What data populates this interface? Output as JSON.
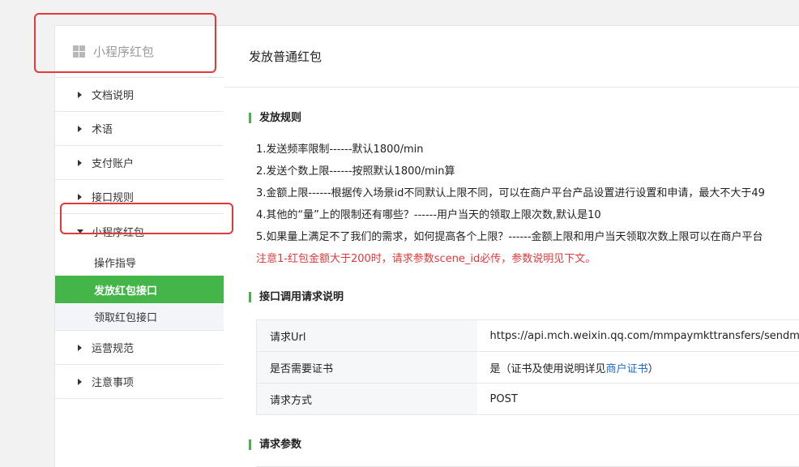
{
  "sidebar": {
    "title": "小程序红包",
    "items": [
      {
        "label": "文档说明"
      },
      {
        "label": "术语"
      },
      {
        "label": "支付账户"
      },
      {
        "label": "接口规则"
      }
    ],
    "open_item": {
      "label": "小程序红包",
      "children": [
        {
          "label": "操作指导"
        },
        {
          "label": "发放红包接口"
        },
        {
          "label": "领取红包接口"
        }
      ]
    },
    "items_after": [
      {
        "label": "运营规范"
      },
      {
        "label": "注意事项"
      }
    ]
  },
  "main": {
    "page_title": "发放普通红包",
    "rules_section": {
      "title": "发放规则",
      "lines": [
        "1.发送频率限制------默认1800/min",
        "2.发送个数上限------按照默认1800/min算",
        "3.金额上限------根据传入场景id不同默认上限不同，可以在商户平台产品设置进行设置和申请，最大不大于49",
        "4.其他的“量”上的限制还有哪些？------用户当天的领取上限次数,默认是10",
        "5.如果量上满足不了我们的需求，如何提高各个上限？------金额上限和用户当天领取次数上限可以在商户平台"
      ],
      "warning": "注意1-红包金额大于200时，请求参数scene_id必传，参数说明见下文。"
    },
    "request_section": {
      "title": "接口调用请求说明",
      "rows": [
        {
          "key": "请求Url",
          "value": "https://api.mch.weixin.qq.com/mmpaymkttransfers/sendminipr"
        },
        {
          "key": "是否需要证书",
          "value_prefix": "是（证书及使用说明详见",
          "value_link": "商户证书",
          "value_suffix": "）"
        },
        {
          "key": "请求方式",
          "value": "POST"
        }
      ]
    },
    "params_section": {
      "title": "请求参数"
    }
  },
  "colors": {
    "accent_green": "#44b549",
    "warning_red": "#e4393c",
    "highlight_red": "#e03a3a",
    "link_blue": "#1e6bd6"
  }
}
